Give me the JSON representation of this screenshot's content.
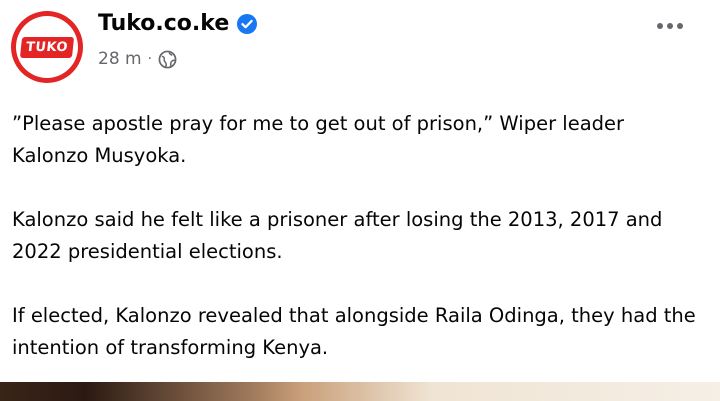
{
  "post": {
    "page_name": "Tuko.co.ke",
    "logo_text": "TUKO",
    "time": "28 m",
    "separator": "·",
    "verified_icon": "verified-badge-icon",
    "audience_icon": "globe-icon",
    "more_icon": "more-options-icon",
    "paragraphs": [
      "”Please apostle pray for me to get out of prison,” Wiper leader Kalonzo Musyoka.",
      "Kalonzo said he felt like a prisoner after losing the 2013, 2017 and 2022 presidential elections.",
      "If elected, Kalonzo revealed that alongside Raila Odinga, they had the intention of transforming Kenya."
    ]
  },
  "colors": {
    "brand_red": "#e32525",
    "verified_blue": "#1877f2",
    "meta_gray": "#65676b",
    "text": "#050505"
  }
}
